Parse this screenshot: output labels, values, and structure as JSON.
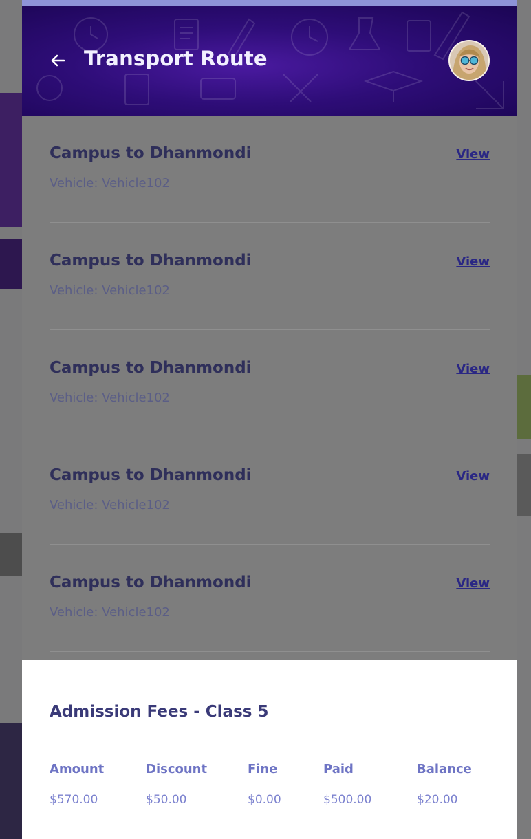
{
  "header": {
    "title": "Transport Route"
  },
  "routes": [
    {
      "name": "Campus to Dhanmondi",
      "vehicle": "Vehicle: Vehicle102",
      "action": "View"
    },
    {
      "name": "Campus to Dhanmondi",
      "vehicle": "Vehicle: Vehicle102",
      "action": "View"
    },
    {
      "name": "Campus to Dhanmondi",
      "vehicle": "Vehicle: Vehicle102",
      "action": "View"
    },
    {
      "name": "Campus to Dhanmondi",
      "vehicle": "Vehicle: Vehicle102",
      "action": "View"
    },
    {
      "name": "Campus to Dhanmondi",
      "vehicle": "Vehicle: Vehicle102",
      "action": "View"
    }
  ],
  "fees": {
    "title": "Admission Fees - Class 5",
    "columns": [
      {
        "label": "Amount",
        "value": "$570.00"
      },
      {
        "label": "Discount",
        "value": "$50.00"
      },
      {
        "label": "Fine",
        "value": "$0.00"
      },
      {
        "label": "Paid",
        "value": "$500.00"
      },
      {
        "label": "Balance",
        "value": "$20.00"
      }
    ]
  },
  "colors": {
    "header_bg": "#2e0d78",
    "accent_top": "#8e93d8",
    "link": "#2a2784",
    "fee_label": "#6e74c4"
  },
  "icons": {
    "back": "arrow-left-icon",
    "avatar": "user-avatar"
  }
}
